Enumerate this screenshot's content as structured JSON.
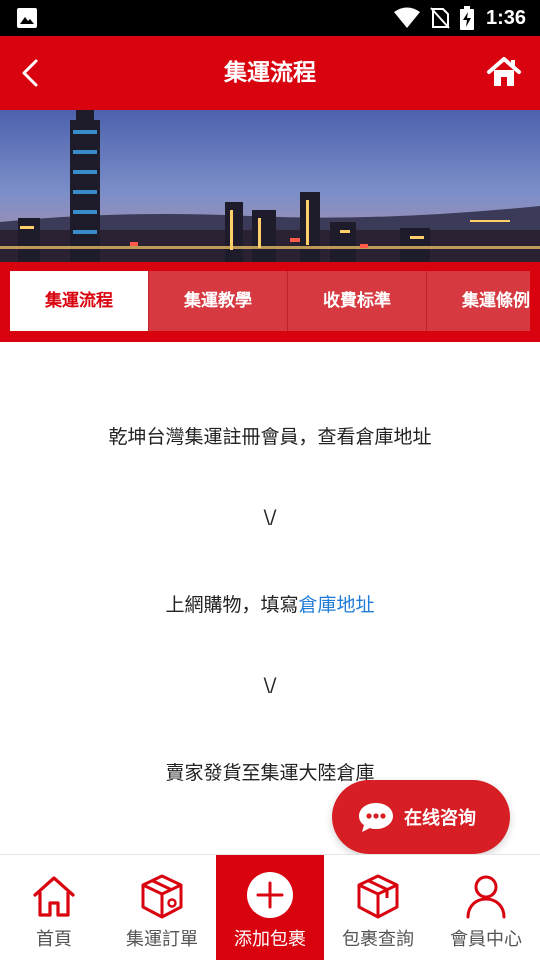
{
  "status_bar": {
    "time": "1:36",
    "icons": [
      "image-icon",
      "wifi-icon",
      "no-sim-icon",
      "battery-charging-icon"
    ]
  },
  "header": {
    "title": "集運流程",
    "back_icon": "chevron-left-icon",
    "home_icon": "home-icon"
  },
  "tabs": [
    {
      "label": "集運流程",
      "active": true
    },
    {
      "label": "集運教學",
      "active": false
    },
    {
      "label": "收費标準",
      "active": false
    },
    {
      "label": "集運條例",
      "active": false
    }
  ],
  "content": {
    "step1": "乾坤台灣集運註冊會員，查看倉庫地址",
    "arrow": "\\/",
    "step2_text": "上網購物，填寫",
    "step2_link": "倉庫地址",
    "step3": "賣家發貨至集運大陸倉庫"
  },
  "consult": {
    "label": "在线咨询",
    "icon": "chat-bubble-icon"
  },
  "bottom_nav": [
    {
      "label": "首頁",
      "icon": "home-icon"
    },
    {
      "label": "集運訂單",
      "icon": "package-icon"
    },
    {
      "label": "添加包裹",
      "icon": "plus-circle-icon"
    },
    {
      "label": "包裹查詢",
      "icon": "box-icon"
    },
    {
      "label": "會員中心",
      "icon": "user-icon"
    }
  ],
  "colors": {
    "brand_red": "#d9030f",
    "link_blue": "#1e7bd6",
    "status_bar": "#000000"
  }
}
